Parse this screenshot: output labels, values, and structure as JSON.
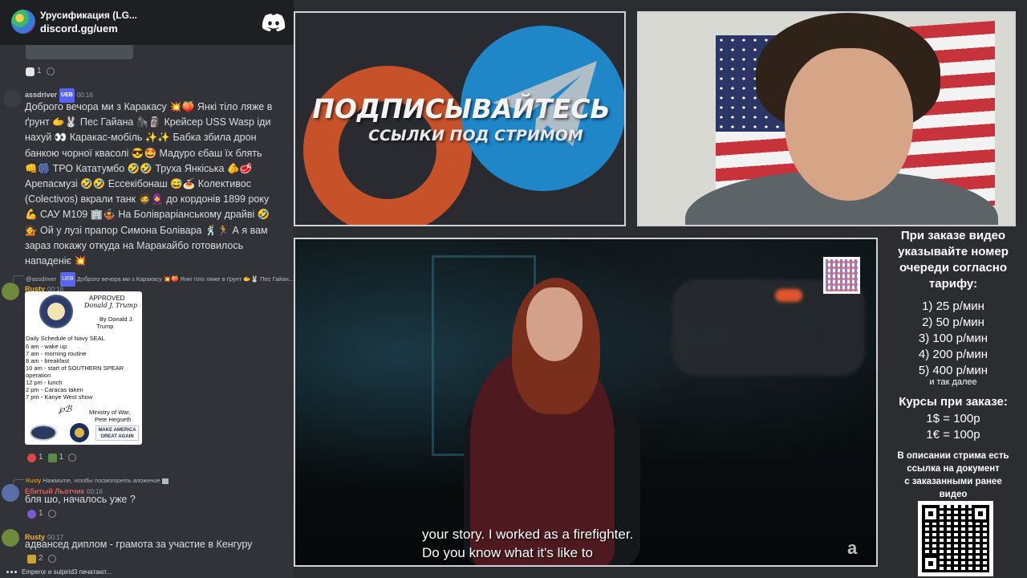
{
  "discord": {
    "server_name": "Урусификация (LG...",
    "invite": "discord.gg/uem",
    "top_reactions": {
      "comment_count": "1"
    },
    "msg1": {
      "author": "assdriver",
      "badge": "UEB",
      "time": "00:16",
      "lines": [
        "Доброго вечора ми з Каракасу 💥🍑 Янкі тіло ляже в",
        "ґрунт 🫱🐰 Пес Гайана 🦍🗿 Крейсер USS Wasp іди",
        "нахуй 👀 Каракас-мобіль ✨✨ Бабка збила дрон",
        "банкою чорної квасолі 😎🤩 Мадуро єбаш їх блять",
        "👊🎆 ТРО Кататумбо 🤣🤣 Труха Янкіська 🫵🥩",
        "Арепасмузі 🤣🤣 Ессекібонаш 😅🍝 Колективос",
        "(Colectivos) вкрали танк 🧔🧕 до кордонів 1899 року",
        "💪 САУ М109 🏢🤹 На Болівраріанському драйві 🤣",
        "💁 Ой у лузі прапор Симона Болівара 🕺🏃 А я вам",
        "зараз покажу откуда на Маракайбо готовилось",
        "нападеніє 💥"
      ]
    },
    "msg2": {
      "reply_to": "@assdriver",
      "reply_badge": "UEB",
      "reply_text": "Доброго вечора ми з Каракасу 💥🍑 Янкі тіло ляже в ґрунт 🫱🐰 Пес Гайан...",
      "author": "Rusty",
      "time": "00:16",
      "card": {
        "approved": "APPROVED",
        "signature": "Donald J. Trump",
        "by": "By Donald J.",
        "by_name": "Trump",
        "schedule_title": "Daily Schedule of Navy SEAL",
        "schedule": [
          "6 am - wake up",
          "7 am - morning routine",
          "8 am - breakfast",
          "10 am - start of SOUTHERN SPEAR",
          "operation",
          "12 pm - lunch",
          "2 pm - Caracas taken",
          "7 pm - Kanye West show"
        ],
        "ministry": "Ministry of War,",
        "minister": "Pete Hegseth",
        "maga1": "MAKE AMERICA",
        "maga2": "GREAT AGAIN"
      },
      "reactions": [
        "1",
        "1"
      ]
    },
    "msg3": {
      "reply_to": "Rusty",
      "reply_text": "Нажмите, чтобы посмотреть вложение",
      "author": "Ебитый Льотчик",
      "time": "00:16",
      "text": "бля шо, началось уже ?",
      "reactions": [
        "1"
      ]
    },
    "msg4": {
      "author": "Rusty",
      "time": "00:17",
      "text": "адвансед диплом - грамота за участие в Кенгуру",
      "reactions": [
        "2"
      ]
    },
    "typing": "Emperor и sulpirid3 печатают..."
  },
  "banner": {
    "title": "ПОДПИСЫВАЙТЕСЬ",
    "subtitle": "ССЫЛКИ ПОД СТРИМОМ"
  },
  "video": {
    "subtitle_line1": "your story. I worked as a firefighter.",
    "subtitle_line2": "Do you know what it's like to",
    "logo": "a"
  },
  "info": {
    "order_text": [
      "При заказе видео",
      "указывайте номер",
      "очереди согласно",
      "тарифу:"
    ],
    "tariffs": [
      "1) 25 р/мин",
      "2) 50 р/мин",
      "3) 100 р/мин",
      "4) 200 р/мин",
      "5) 400 р/мин"
    ],
    "etc": "и так далее",
    "rates_title": "Курсы при заказе:",
    "rates": [
      "1$ = 100р",
      "1€ = 100р"
    ],
    "description": [
      "В описании стрима есть",
      "ссылка на документ",
      "с заказанными ранее",
      "видео"
    ]
  },
  "colors": {
    "discord_bg": "#313338",
    "discord_header": "#1e1f22",
    "rusty_name": "#f0b232",
    "pilot_name": "#e85c5c",
    "telegram_blue": "#1f86c8",
    "patreon_orange": "#c7522a"
  }
}
